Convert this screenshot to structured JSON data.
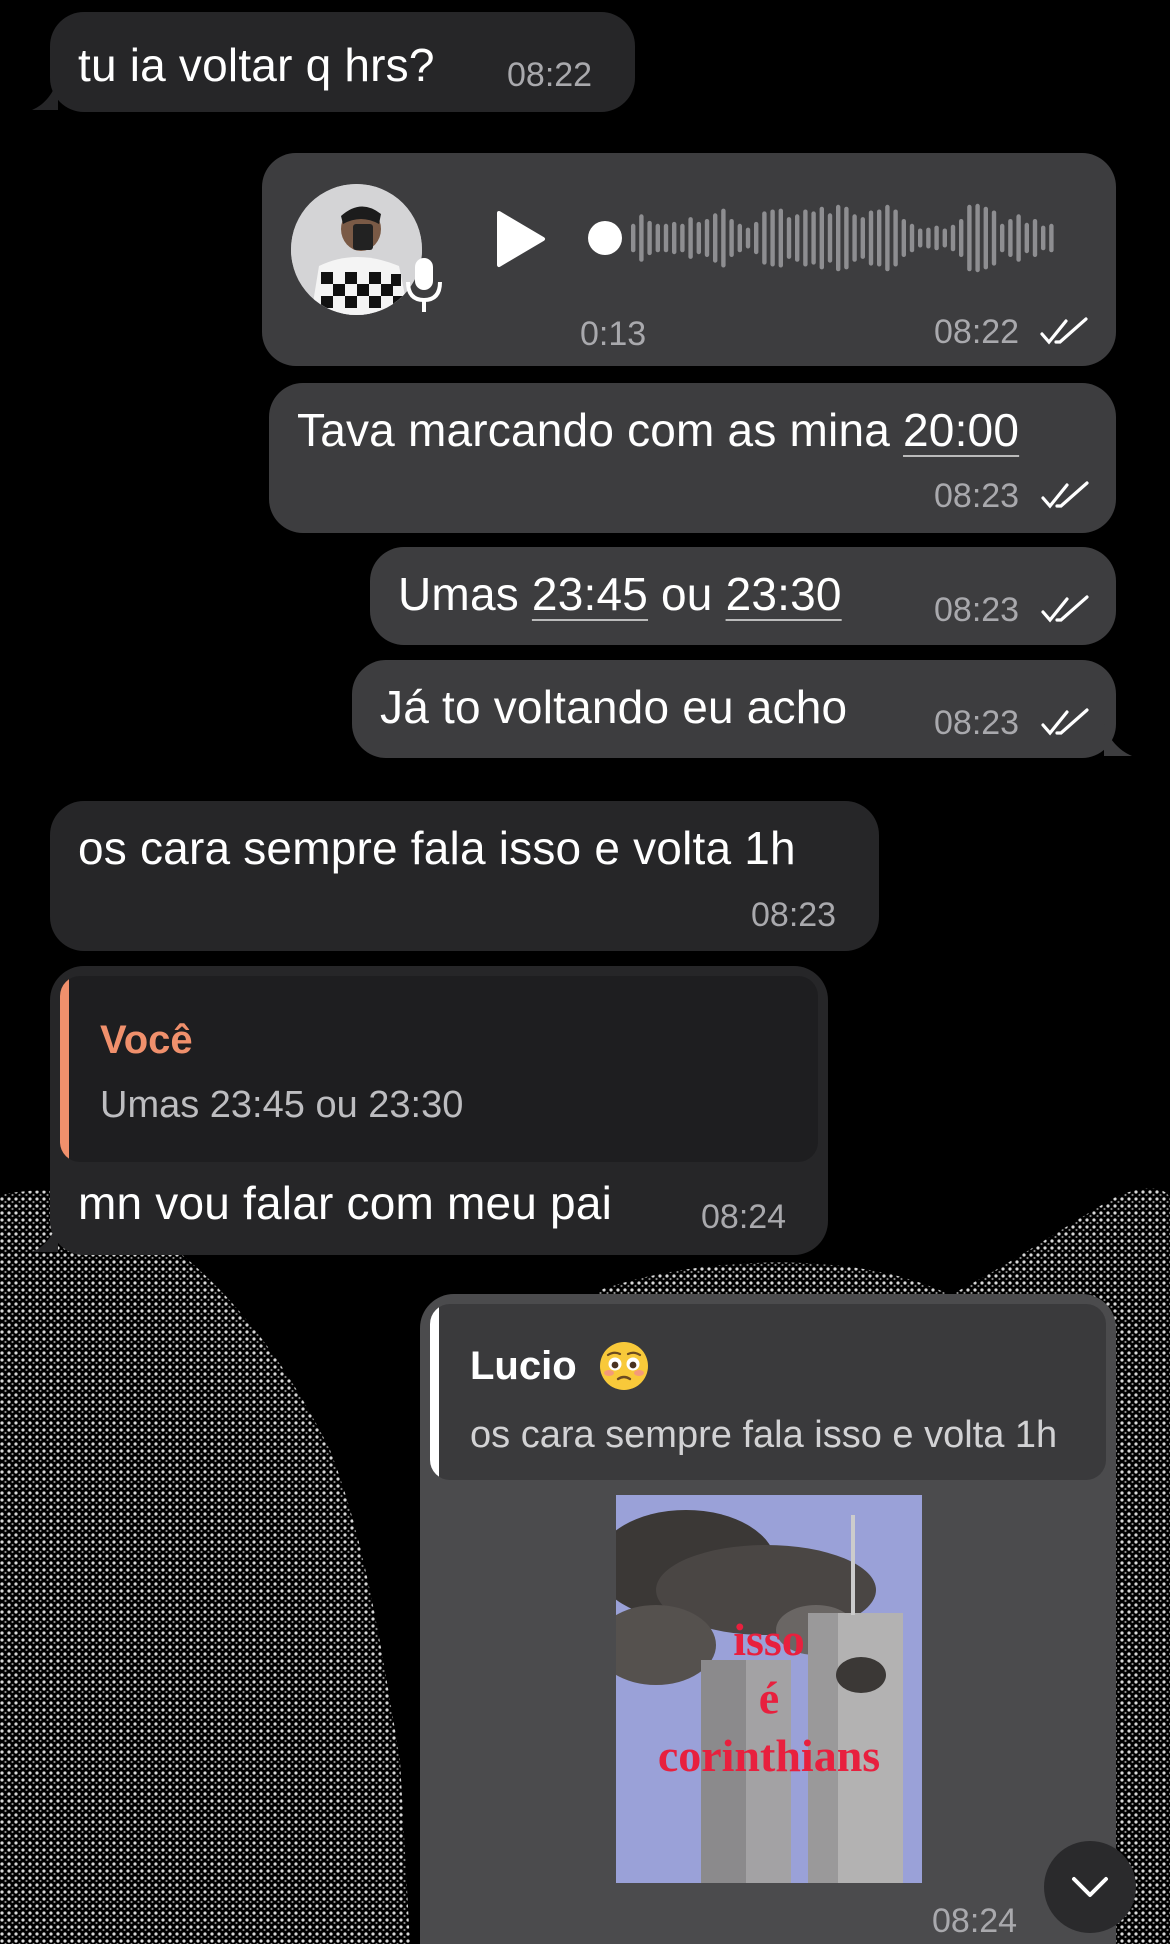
{
  "theme": {
    "incoming_bubble": "#262628",
    "outgoing_bubble": "#3d3d3f",
    "reply_accent_you": "#f0906c",
    "reply_accent_lucio": "#ffffff",
    "time_color": "#a9a9ad",
    "tick_icon": "double-check-icon"
  },
  "messages": {
    "m1": {
      "text": "tu ia voltar q hrs?",
      "time": "08:22"
    },
    "voice": {
      "duration": "0:13",
      "time": "08:22",
      "played_fraction": 0.0
    },
    "m2": {
      "text": "Tava marcando com as mina ",
      "link": "20:00",
      "time": "08:23"
    },
    "m3": {
      "prefix": "Umas ",
      "link1": "23:45",
      "mid": " ou ",
      "link2": "23:30",
      "time": "08:23"
    },
    "m4": {
      "text": "Já to voltando eu acho",
      "time": "08:23"
    },
    "m5": {
      "text": "os cara sempre fala isso e volta 1h",
      "time": "08:23"
    },
    "m6": {
      "quote_name": "Você",
      "quote_text": "Umas 23:45 ou 23:30",
      "text": "mn vou falar com meu pai",
      "time": "08:24"
    },
    "m7": {
      "quote_name": "Lucio",
      "quote_emoji": "flushed-pleading-face-emoji",
      "quote_text": "os cara sempre fala isso e volta 1h",
      "image_caption": [
        "isso",
        "é",
        "corinthians"
      ],
      "time": "08:24"
    }
  },
  "scroll_button": {
    "icon": "chevron-down-icon"
  }
}
